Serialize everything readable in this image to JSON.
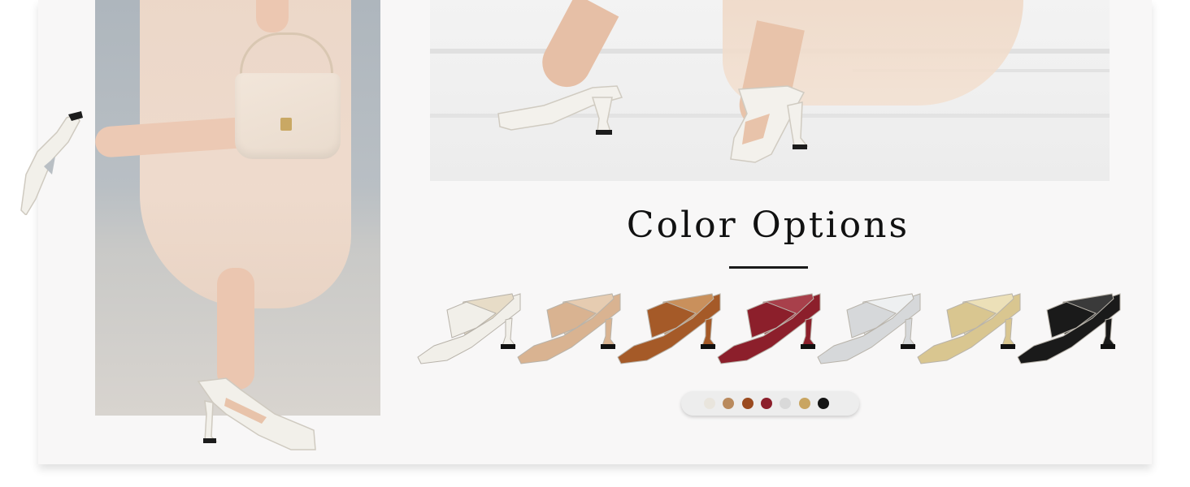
{
  "heading": "Color Options",
  "colors": {
    "card": "#f8f7f7",
    "heading": "#111111",
    "accent_rule": "#1a1a1a"
  },
  "product_variants": [
    {
      "name": "white-shoe",
      "color": "#f1efe9",
      "insole": "#e7dcc7"
    },
    {
      "name": "nude-shoe",
      "color": "#d9b391",
      "insole": "#e6ccb1"
    },
    {
      "name": "brown-shoe",
      "color": "#a55a28",
      "insole": "#c9905c"
    },
    {
      "name": "burgundy-shoe",
      "color": "#8c1f2b",
      "insole": "#a8404b"
    },
    {
      "name": "silver-shoe",
      "color": "#d6d8da",
      "insole": "#eef0f1"
    },
    {
      "name": "gold-shoe",
      "color": "#d9c690",
      "insole": "#ece0b8"
    },
    {
      "name": "black-shoe",
      "color": "#1a1a1a",
      "insole": "#3a3a3a"
    }
  ],
  "swatches": [
    {
      "name": "white-swatch",
      "color": "#e9e5dd"
    },
    {
      "name": "nude-swatch",
      "color": "#b98a5d"
    },
    {
      "name": "brown-swatch",
      "color": "#9a4a1f"
    },
    {
      "name": "burgundy-swatch",
      "color": "#8c1f2b"
    },
    {
      "name": "silver-swatch",
      "color": "#d9d9d9"
    },
    {
      "name": "gold-swatch",
      "color": "#c9a561"
    },
    {
      "name": "black-swatch",
      "color": "#141414"
    }
  ]
}
